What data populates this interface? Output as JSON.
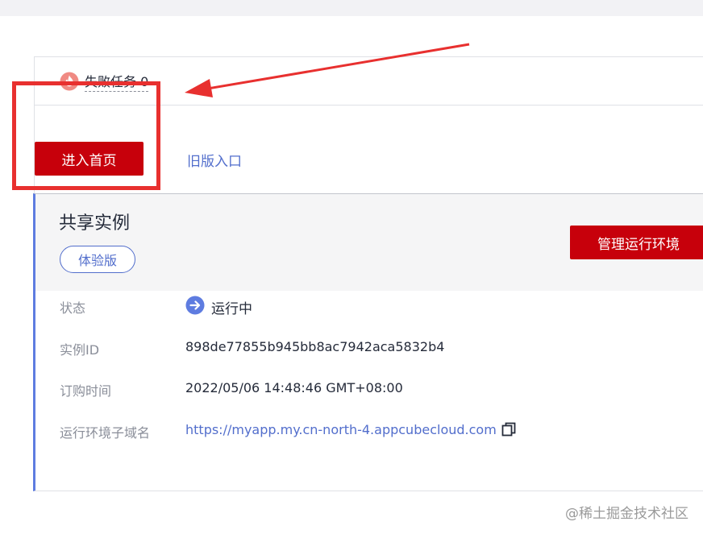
{
  "failed_tasks": {
    "label": "失败任务 0"
  },
  "actions": {
    "enter_home": "进入首页",
    "old_version": "旧版入口"
  },
  "instance": {
    "title": "共享实例",
    "badge": "体验版",
    "manage_button": "管理运行环境",
    "rows": {
      "status_label": "状态",
      "status_value": "运行中",
      "id_label": "实例ID",
      "id_value": "898de77855b945bb8ac7942aca5832b4",
      "order_time_label": "订购时间",
      "order_time_value": "2022/05/06 14:48:46 GMT+08:00",
      "domain_label": "运行环境子域名",
      "domain_value": "https://myapp.my.cn-north-4.appcubecloud.com"
    }
  },
  "watermark": "@稀土掘金技术社区",
  "colors": {
    "primary_red": "#c7000b",
    "link_blue": "#526ecc",
    "accent_border": "#5e7ce0",
    "annotation_red": "#e8302f"
  },
  "icons": {
    "failed": "fire-icon",
    "status": "arrow-right-circle-icon",
    "copy": "copy-icon"
  }
}
